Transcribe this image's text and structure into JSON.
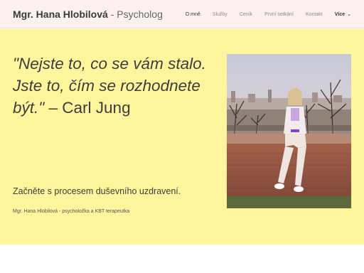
{
  "header": {
    "name": "Mgr. Hana Hlobilová",
    "separator": " - ",
    "role": "Psycholog"
  },
  "nav": {
    "items": [
      {
        "label": "O mně"
      },
      {
        "label": "Služby"
      },
      {
        "label": "Ceník"
      },
      {
        "label": "První setkání"
      },
      {
        "label": "Kontakt"
      }
    ],
    "more_label": "Více",
    "more_icon": "chevron-down-icon"
  },
  "hero": {
    "quote_text": "\"Nejste to, co se vám stalo. Jste to, čím se rozhodnete být.\"",
    "quote_author": " – Carl Jung",
    "subtitle": "Začněte s procesem duševního uzdravení.",
    "caption": "Mgr. Hana Hlobilová - psycholožka a KBT terapeutka"
  },
  "colors": {
    "header_bg": "#fcf0f1",
    "hero_bg": "#fff59d",
    "text": "#3d3d3d"
  }
}
